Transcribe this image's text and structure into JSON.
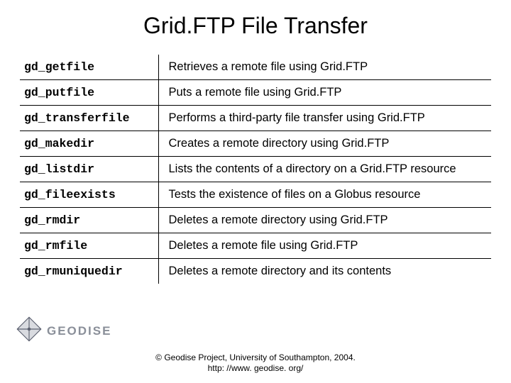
{
  "title": "Grid.FTP File Transfer",
  "rows": [
    {
      "cmd": "gd_getfile",
      "desc": "Retrieves a remote file using Grid.FTP"
    },
    {
      "cmd": "gd_putfile",
      "desc": "Puts a remote file using Grid.FTP"
    },
    {
      "cmd": "gd_transferfile",
      "desc": "Performs a third-party file transfer using Grid.FTP"
    },
    {
      "cmd": "gd_makedir",
      "desc": "Creates a remote directory using Grid.FTP"
    },
    {
      "cmd": "gd_listdir",
      "desc": "Lists the contents of a directory on a Grid.FTP resource"
    },
    {
      "cmd": "gd_fileexists",
      "desc": "Tests the existence of files on a Globus resource"
    },
    {
      "cmd": "gd_rmdir",
      "desc": "Deletes a remote directory using Grid.FTP"
    },
    {
      "cmd": "gd_rmfile",
      "desc": "Deletes a remote file using Grid.FTP"
    },
    {
      "cmd": "gd_rmuniquedir",
      "desc": "Deletes a remote directory and its contents"
    }
  ],
  "logo_text": "GEODISE",
  "credit_line1": "© Geodise Project, University of Southampton, 2004.",
  "credit_line2": "http: //www. geodise. org/"
}
